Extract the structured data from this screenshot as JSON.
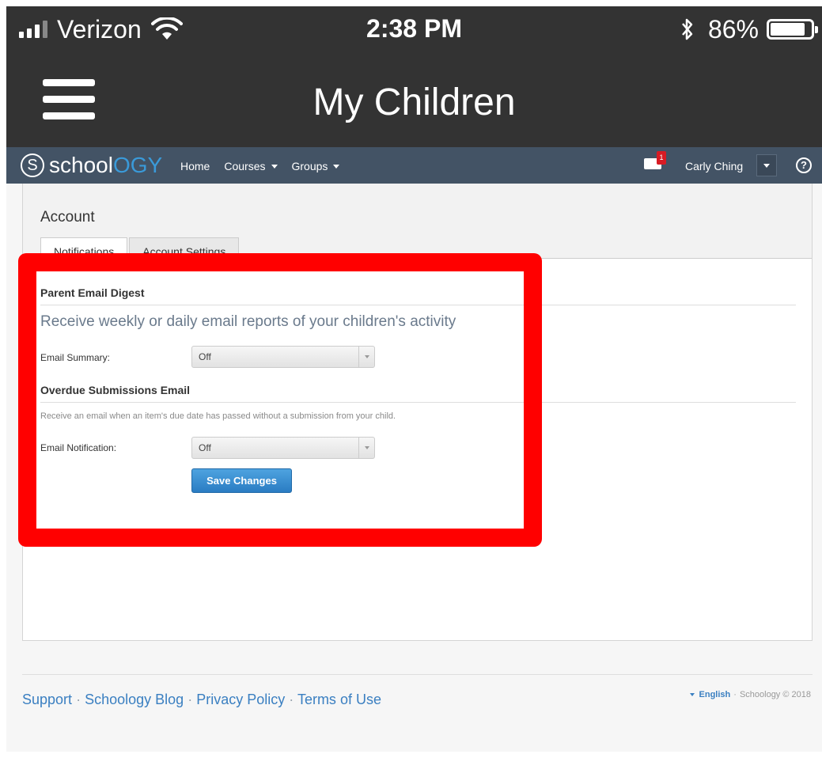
{
  "status_bar": {
    "carrier": "Verizon",
    "time": "2:38 PM",
    "battery_percent": "86%",
    "battery_level": 0.86,
    "icons": [
      "signal-icon",
      "wifi-icon",
      "bluetooth-icon",
      "battery-icon"
    ]
  },
  "nav_bar": {
    "title": "My Children",
    "menu_icon": "hamburger-menu-icon"
  },
  "schoology_header": {
    "logo_prefix": "school",
    "logo_suffix": "OGY",
    "logo_glyph": "S",
    "nav": [
      {
        "label": "Home"
      },
      {
        "label": "Courses"
      },
      {
        "label": "Groups"
      }
    ],
    "message_badge": "1",
    "user_name": "Carly Ching",
    "help_glyph": "?",
    "accent_color": "#3a9ad9",
    "header_color": "#435365"
  },
  "account": {
    "title": "Account",
    "tabs": [
      {
        "label": "Notifications",
        "active": true
      },
      {
        "label": "Account Settings",
        "active": false
      }
    ]
  },
  "parent_digest": {
    "title": "Parent Email Digest",
    "description": "Receive weekly or daily email reports of your children's activity",
    "field_label": "Email Summary:",
    "value": "Off"
  },
  "overdue": {
    "title": "Overdue Submissions Email",
    "description": "Receive an email when an item's due date has passed without a submission from your child.",
    "field_label": "Email Notification:",
    "value": "Off"
  },
  "save_button": "Save Changes",
  "highlight_color": "#ff0000",
  "footer": {
    "links": [
      {
        "label": "Support"
      },
      {
        "label": "Schoology Blog"
      },
      {
        "label": "Privacy Policy"
      },
      {
        "label": "Terms of Use"
      }
    ],
    "separator": "·",
    "language": "English",
    "copyright": "Schoology © 2018"
  }
}
